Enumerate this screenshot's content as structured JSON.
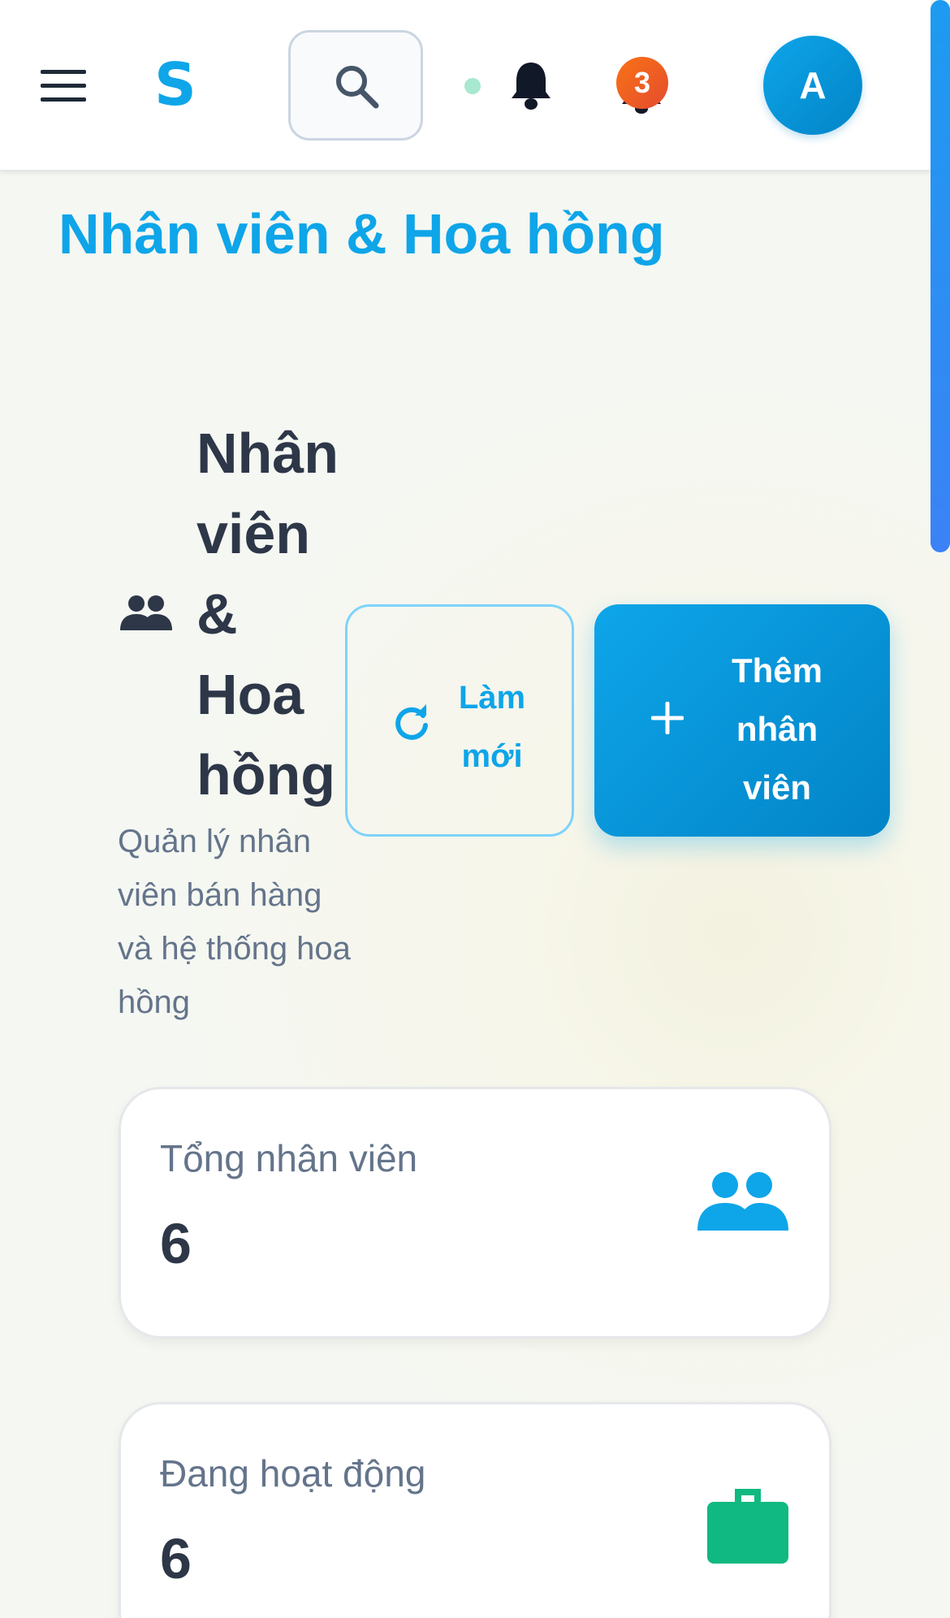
{
  "header": {
    "logo": "S",
    "notification_count": "3",
    "avatar_initial": "A"
  },
  "page_title": "Nhân viên & Hoa hồng",
  "section": {
    "title": "Nhân viên & Hoa hồng",
    "subtitle": "Quản lý nhân viên bán hàng và hệ thống hoa hồng"
  },
  "actions": {
    "refresh_label": "Làm mới",
    "add_label": "Thêm nhân viên"
  },
  "stats": [
    {
      "label": "Tổng nhân viên",
      "value": "6",
      "icon": "people-icon",
      "color": "#0ea5e9"
    },
    {
      "label": "Đang hoạt động",
      "value": "6",
      "icon": "briefcase-icon",
      "color": "#10b981"
    }
  ],
  "colors": {
    "accent": "#0ea5e9",
    "badge": "#f97316",
    "success": "#10b981"
  }
}
